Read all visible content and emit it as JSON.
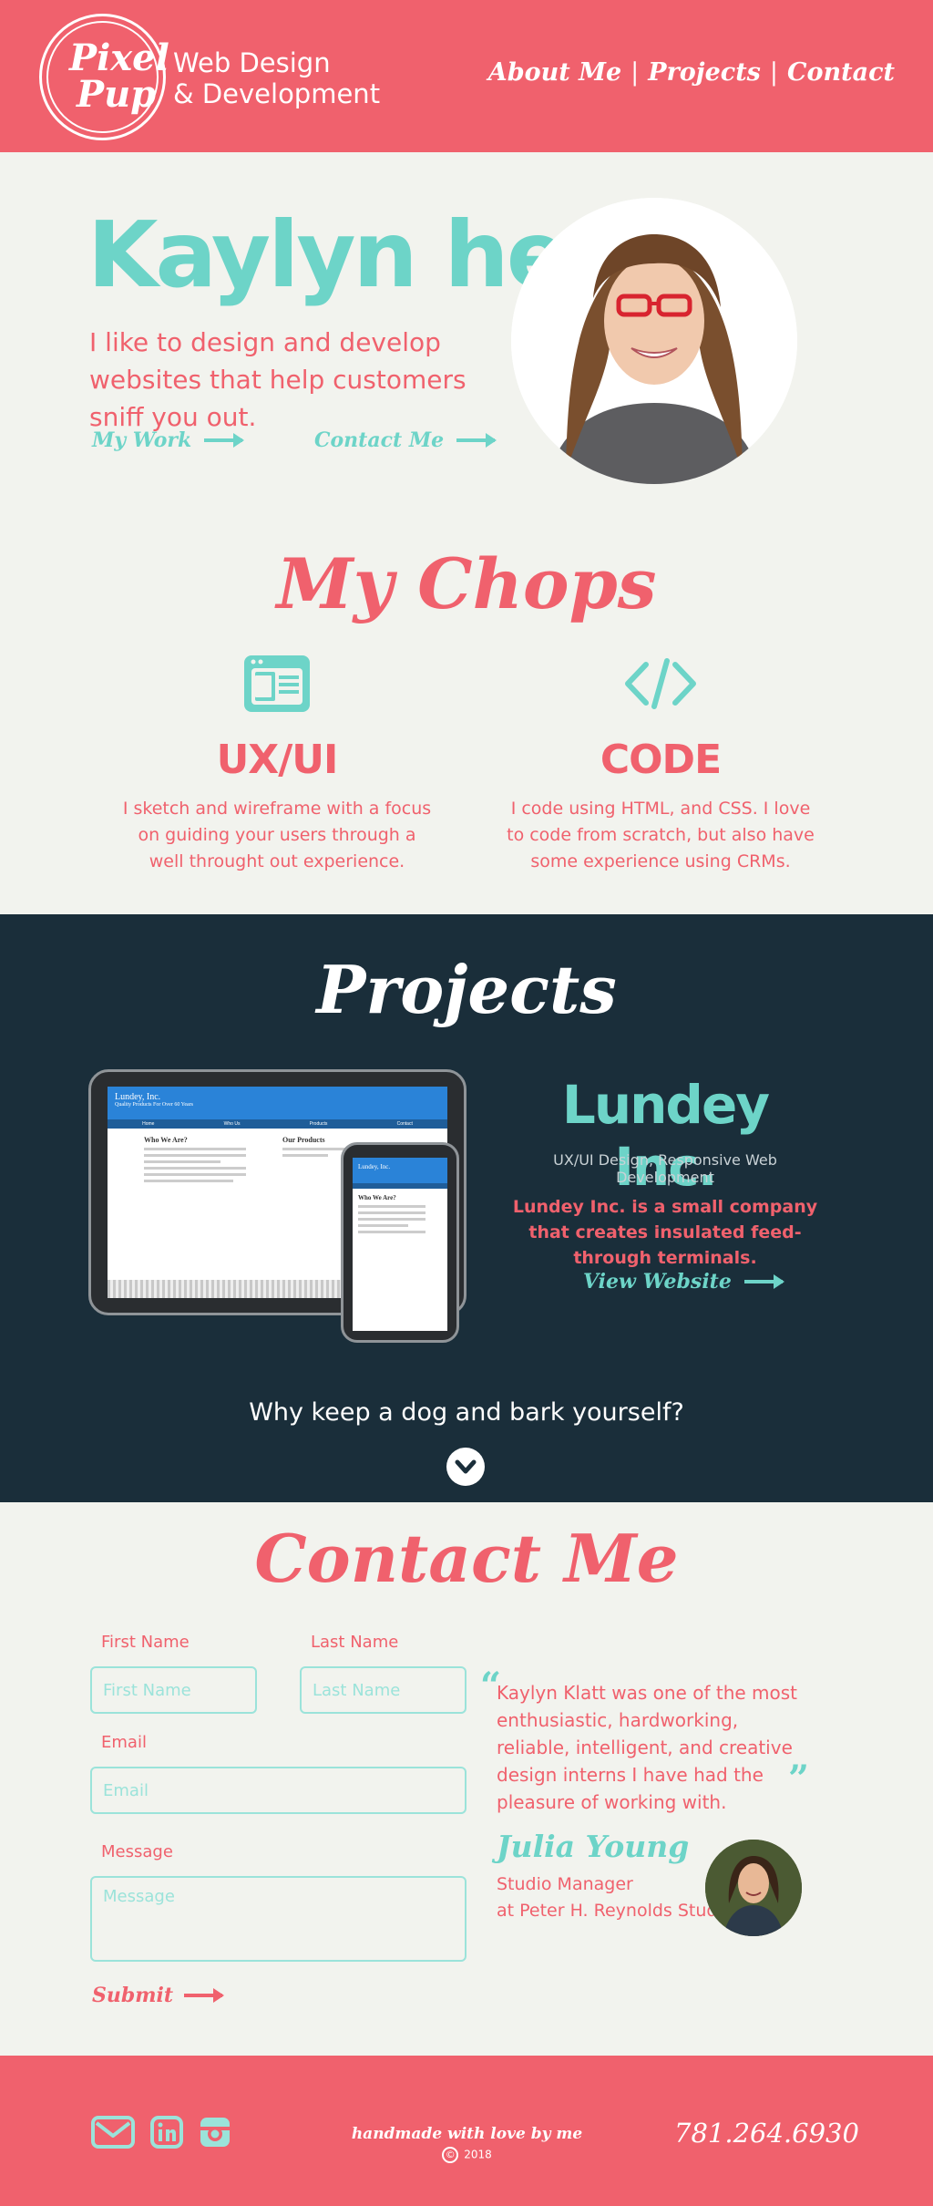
{
  "colors": {
    "coral": "#f0616d",
    "teal": "#6dd4c8",
    "navy": "#1a2e3a",
    "cream": "#f2f3ee"
  },
  "header": {
    "logo_word1": "Pixel",
    "logo_word2": "Pup",
    "tagline_line1": "Web Design",
    "tagline_line2": "& Development",
    "nav": [
      {
        "label": "About Me"
      },
      {
        "label": "Projects"
      },
      {
        "label": "Contact"
      }
    ],
    "nav_separator": "|"
  },
  "hero": {
    "title": "Kaylyn here,",
    "subtitle": "I like to design and develop websites that help customers sniff you out.",
    "link_work": "My Work",
    "link_contact": "Contact Me",
    "portrait_icon": "person-photo-icon"
  },
  "chops": {
    "title": "My Chops",
    "items": [
      {
        "icon": "browser-window-icon",
        "heading": "UX/UI",
        "text": "I sketch and wireframe with a focus on guiding your users through a well throught out experience."
      },
      {
        "icon": "code-brackets-icon",
        "heading": "CODE",
        "text": "I code using HTML, and CSS. I love to code from scratch, but also have some experience using CRMs."
      }
    ]
  },
  "projects": {
    "title": "Projects",
    "mockup": {
      "company": "Lundey, Inc.",
      "tagline": "Quality Products For Over 60 Years",
      "nav": [
        "Home",
        "Who Us",
        "Products",
        "Contact"
      ],
      "heading_left": "Who We Are?",
      "heading_right": "Our Products"
    },
    "name": "Lundey Inc.",
    "type": "UX/UI Design, Responsive Web Development",
    "description": "Lundey Inc. is a small company that creates insulated feed-through terminals.",
    "link": "View Website",
    "quote": "Why keep a dog and bark yourself?"
  },
  "contact": {
    "title": "Contact Me",
    "first_name_label": "First Name",
    "first_name_placeholder": "First Name",
    "last_name_label": "Last Name",
    "last_name_placeholder": "Last Name",
    "email_label": "Email",
    "email_placeholder": "Email",
    "message_label": "Message",
    "message_placeholder": "Message",
    "submit": "Submit"
  },
  "testimonial": {
    "open_quote": "“",
    "close_quote": "”",
    "text": "Kaylyn Klatt was one of the most enthusiastic, hardworking, reliable, intelligent, and creative design interns I have had the pleasure of working with.",
    "name": "Julia Young",
    "role_line1": "Studio Manager",
    "role_line2": "at Peter H. Reynolds Studio"
  },
  "footer": {
    "social": [
      {
        "icon": "mail-icon"
      },
      {
        "icon": "linkedin-icon"
      },
      {
        "icon": "camera-icon"
      }
    ],
    "credit": "handmade with love by me",
    "copyright_symbol": "©",
    "year": "2018",
    "phone": "781.264.6930"
  }
}
